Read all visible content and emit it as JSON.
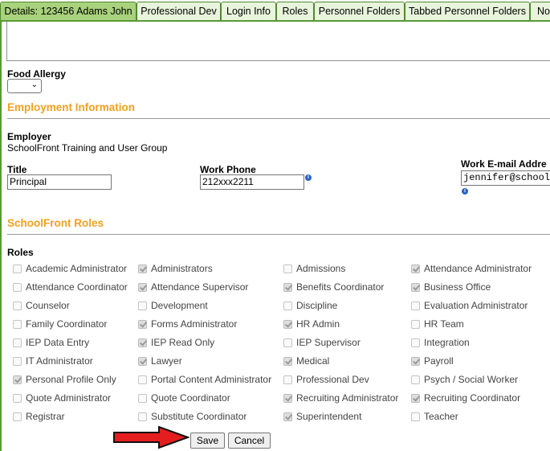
{
  "tabs": [
    {
      "label": "Details: 123456 Adams John",
      "active": true
    },
    {
      "label": "Professional Dev",
      "active": false
    },
    {
      "label": "Login Info",
      "active": false
    },
    {
      "label": "Roles",
      "active": false
    },
    {
      "label": "Personnel Folders",
      "active": false
    },
    {
      "label": "Tabbed Personnel Folders",
      "active": false
    },
    {
      "label": "Not",
      "active": false
    }
  ],
  "food_allergy": {
    "label": "Food Allergy",
    "value": ""
  },
  "employment": {
    "heading": "Employment Information",
    "employer_label": "Employer",
    "employer_value": "SchoolFront Training and User Group",
    "title_label": "Title",
    "title_value": "Principal",
    "work_phone_label": "Work Phone",
    "work_phone_value": "212xxx2211",
    "work_email_label": "Work E-mail Addre",
    "work_email_value": "jennifer@school"
  },
  "roles_section": {
    "heading": "SchoolFront Roles",
    "roles_label": "Roles",
    "items": [
      {
        "label": "Academic Administrator",
        "checked": false
      },
      {
        "label": "Administrators",
        "checked": true
      },
      {
        "label": "Admissions",
        "checked": false
      },
      {
        "label": "Attendance Administrator",
        "checked": true
      },
      {
        "label": "Attendance Coordinator",
        "checked": false
      },
      {
        "label": "Attendance Supervisor",
        "checked": true
      },
      {
        "label": "Benefits Coordinator",
        "checked": true
      },
      {
        "label": "Business Office",
        "checked": true
      },
      {
        "label": "Counselor",
        "checked": false
      },
      {
        "label": "Development",
        "checked": false
      },
      {
        "label": "Discipline",
        "checked": false
      },
      {
        "label": "Evaluation Administrator",
        "checked": false
      },
      {
        "label": "Family Coordinator",
        "checked": false
      },
      {
        "label": "Forms Administrator",
        "checked": true
      },
      {
        "label": "HR Admin",
        "checked": true
      },
      {
        "label": "HR Team",
        "checked": false
      },
      {
        "label": "IEP Data Entry",
        "checked": false
      },
      {
        "label": "IEP Read Only",
        "checked": true
      },
      {
        "label": "IEP Supervisor",
        "checked": false
      },
      {
        "label": "Integration",
        "checked": false
      },
      {
        "label": "IT Administrator",
        "checked": false
      },
      {
        "label": "Lawyer",
        "checked": true
      },
      {
        "label": "Medical",
        "checked": true
      },
      {
        "label": "Payroll",
        "checked": true
      },
      {
        "label": "Personal Profile Only",
        "checked": true
      },
      {
        "label": "Portal Content Administrator",
        "checked": false
      },
      {
        "label": "Professional Dev",
        "checked": false
      },
      {
        "label": "Psych / Social Worker",
        "checked": false
      },
      {
        "label": "Quote Administrator",
        "checked": false
      },
      {
        "label": "Quote Coordinator",
        "checked": false
      },
      {
        "label": "Recruiting Administrator",
        "checked": true
      },
      {
        "label": "Recruiting Coordinator",
        "checked": true
      },
      {
        "label": "Registrar",
        "checked": false
      },
      {
        "label": "Substitute Coordinator",
        "checked": false
      },
      {
        "label": "Superintendent",
        "checked": true
      },
      {
        "label": "Teacher",
        "checked": false
      }
    ]
  },
  "buttons": {
    "save": "Save",
    "cancel": "Cancel"
  },
  "colors": {
    "section_heading": "#f0a21e",
    "tab_active": "#a9d27c",
    "tab_inactive": "#e8f5dc",
    "arrow": "#e41e1e"
  },
  "icons": {
    "info": "info-icon",
    "arrow": "red-arrow-icon"
  }
}
